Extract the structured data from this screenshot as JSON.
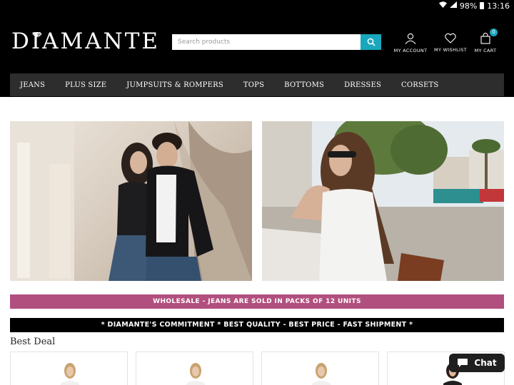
{
  "status_bar": {
    "battery": "98%",
    "time": "13:16",
    "wifi_icon": "wifi-icon",
    "signal_icon": "signal-icon"
  },
  "header": {
    "logo": "DIAMANTE",
    "search": {
      "placeholder": "Search products",
      "value": ""
    },
    "account": {
      "label": "MY ACCOUNT",
      "icon": "user-icon"
    },
    "wishlist": {
      "label": "MY WISHLIST",
      "icon": "heart-icon"
    },
    "cart": {
      "label": "MY CART",
      "count": "0",
      "icon": "bag-icon"
    }
  },
  "nav": [
    "JEANS",
    "PLUS SIZE",
    "JUMPSUITS & ROMPERS",
    "TOPS",
    "BOTTOMS",
    "DRESSES",
    "CORSETS"
  ],
  "banners": {
    "wholesale": "WHOLESALE - JEANS ARE SOLD IN PACKS OF 12 UNITS",
    "commitment": "* DIAMANTE'S COMMITMENT * BEST QUALITY - BEST PRICE - FAST SHIPMENT *"
  },
  "sections": {
    "best_deal": "Best Deal"
  },
  "chat": {
    "label": "Chat",
    "icon": "chat-bubble-icon"
  },
  "colors": {
    "accent": "#19a7bd",
    "wholesale_bg": "#b14f7e",
    "nav_bg": "#2d2d2d",
    "header_bg": "#000000"
  }
}
